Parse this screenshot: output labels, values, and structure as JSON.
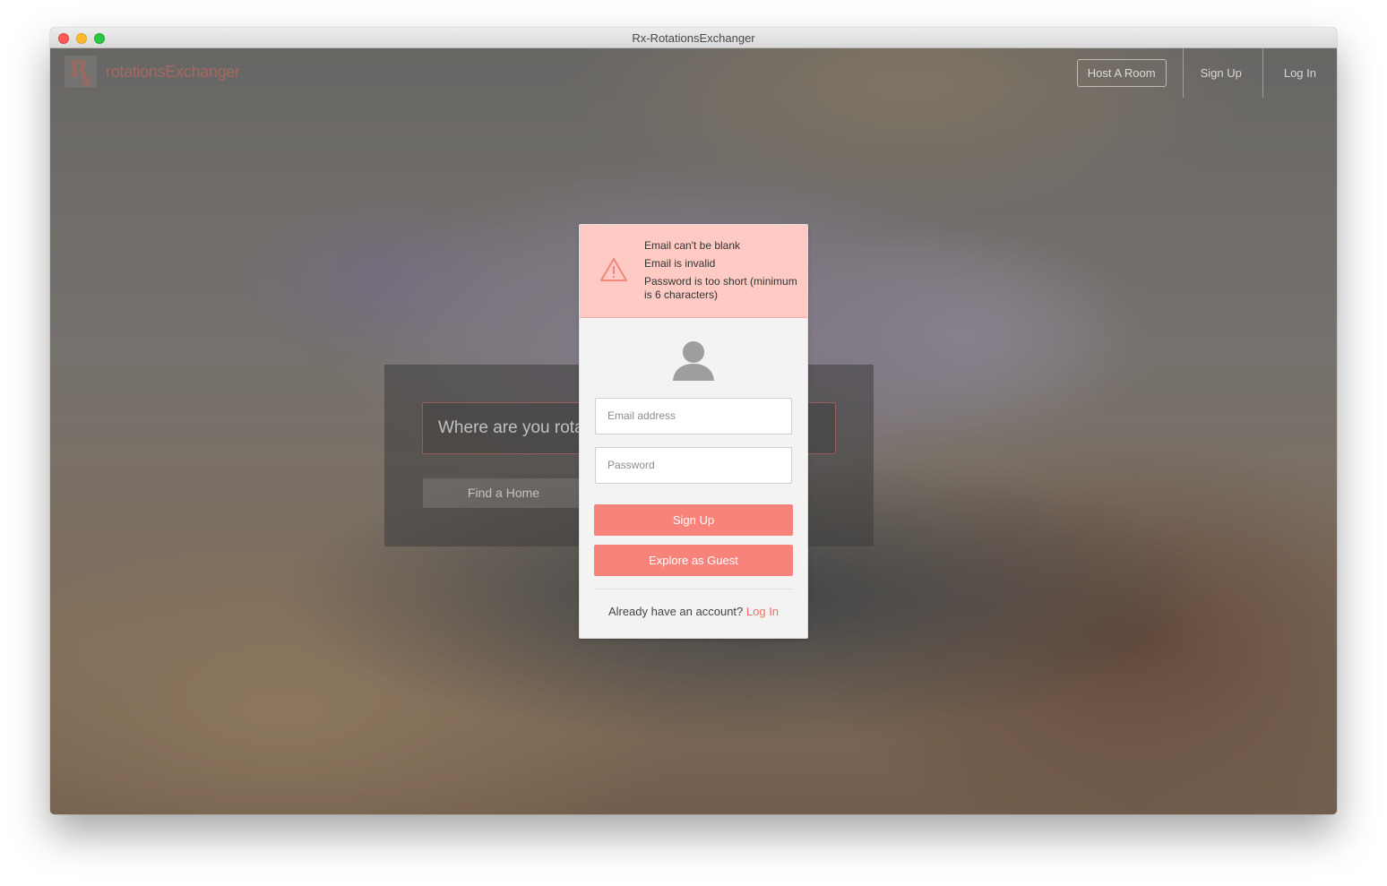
{
  "window": {
    "title": "Rx-RotationsExchanger"
  },
  "header": {
    "logo_text": "rotationsExchanger",
    "nav": {
      "host": "Host A Room",
      "signup": "Sign Up",
      "login": "Log In"
    }
  },
  "search": {
    "placeholder": "Where are you rotati",
    "find_button": "Find a Home"
  },
  "modal": {
    "errors": [
      "Email can't be blank",
      "Email is invalid",
      "Password is too short (minimum is 6 characters)"
    ],
    "email_placeholder": "Email address",
    "password_placeholder": "Password",
    "signup_button": "Sign Up",
    "guest_button": "Explore as Guest",
    "footer_text": "Already have an account?",
    "footer_link": "Log In"
  },
  "colors": {
    "accent": "#f7837a",
    "alert_bg": "#ffcac3",
    "link": "#f26f63"
  },
  "icons": [
    "warning-icon",
    "user-avatar-icon",
    "rx-logo-icon"
  ]
}
